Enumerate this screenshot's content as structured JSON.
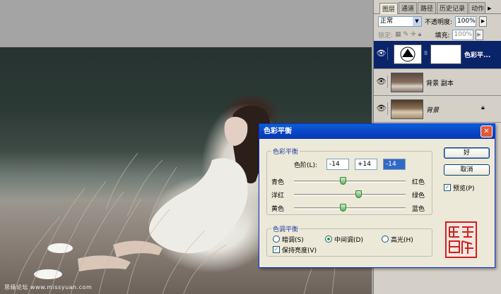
{
  "layers_panel": {
    "tabs": [
      "图层",
      "通道",
      "路径",
      "历史记录",
      "动作"
    ],
    "blend_mode": "正常",
    "opacity_label": "不透明度:",
    "opacity_value": "100%",
    "lock_label": "锁定:",
    "fill_label": "填充:",
    "fill_value": "100%",
    "layers": [
      {
        "name": "色彩平...",
        "selected": true
      },
      {
        "name": "背景 副本",
        "selected": false
      },
      {
        "name": "背景",
        "selected": false
      }
    ]
  },
  "canvas": {
    "watermark": "思缘论坛  www.missyuan.com"
  },
  "dialog": {
    "title": "色彩平衡",
    "color_balance_group": "色彩平衡",
    "levels_label": "色阶(L):",
    "level1": "-14",
    "level2": "+14",
    "level3": "-14",
    "sliders": [
      {
        "left": "青色",
        "right": "红色",
        "value": -14
      },
      {
        "left": "洋红",
        "right": "绿色",
        "value": 14
      },
      {
        "left": "黄色",
        "right": "蓝色",
        "value": -14
      }
    ],
    "tone_group": "色调平衡",
    "tone_options": [
      {
        "label": "暗调(S)",
        "selected": false
      },
      {
        "label": "中间调(D)",
        "selected": true
      },
      {
        "label": "高光(H)",
        "selected": false
      }
    ],
    "preserve_luminosity": "保持亮度(V)",
    "preserve_checked": true,
    "ok": "好",
    "cancel": "取消",
    "preview": "预览(P)",
    "preview_checked": true
  },
  "colors": {
    "title_bar": "#0a46c8",
    "selection": "#0a246a",
    "slider_knob": "#5fb35f"
  }
}
